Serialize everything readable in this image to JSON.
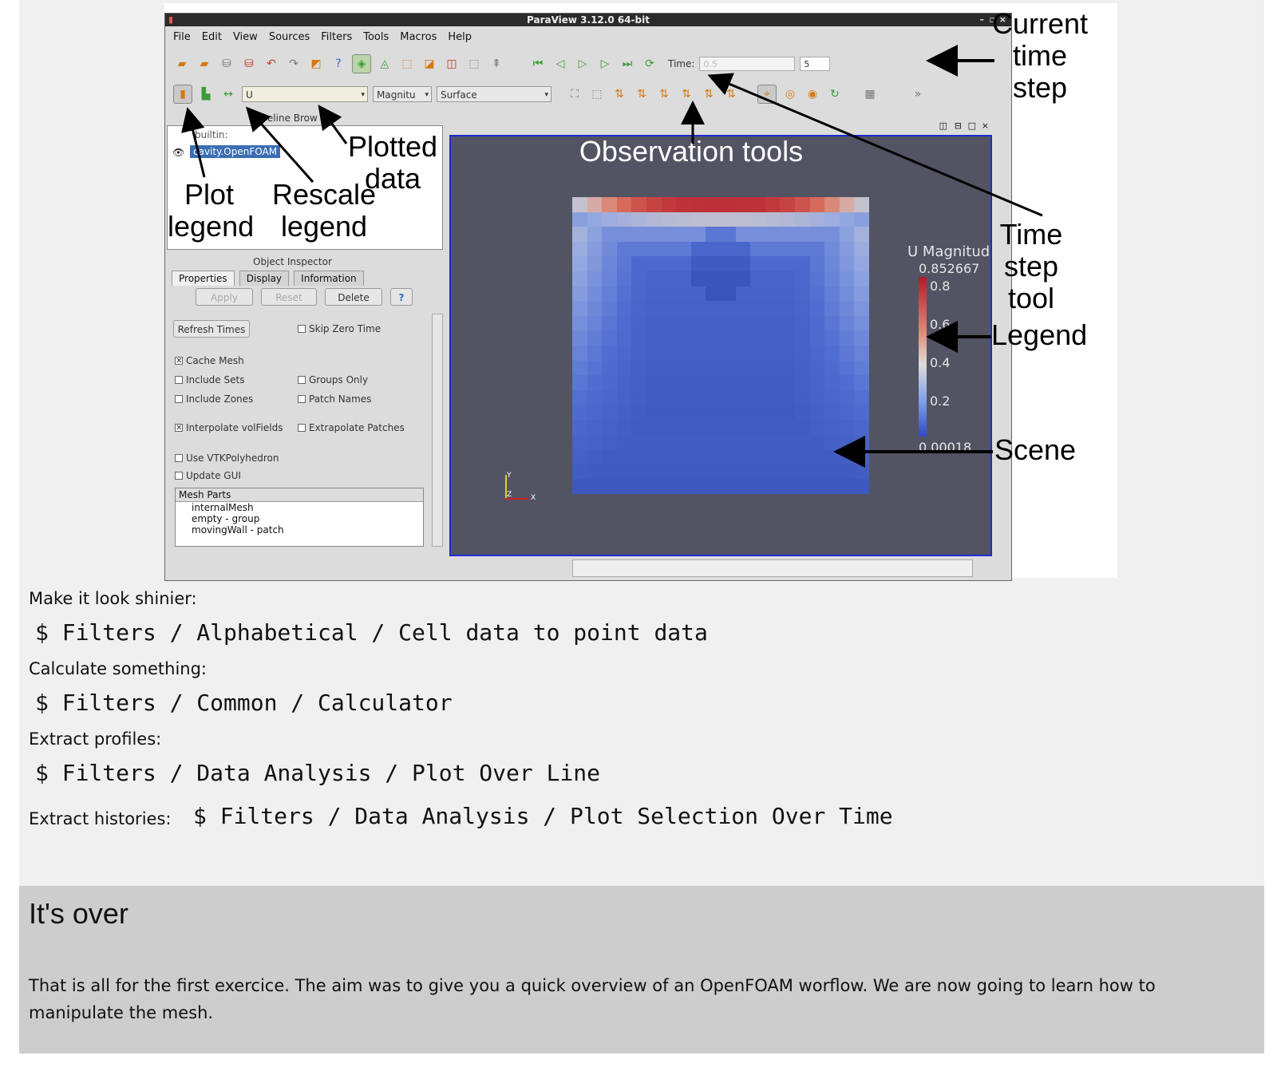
{
  "window": {
    "title": "ParaView 3.12.0 64-bit"
  },
  "menu": [
    "File",
    "Edit",
    "View",
    "Sources",
    "Filters",
    "Tools",
    "Macros",
    "Help"
  ],
  "toolbar": {
    "time_label": "Time:",
    "time_value": "0.5",
    "time_step": "5",
    "variable": "U",
    "component": "Magnitu",
    "representation": "Surface"
  },
  "pipeline": {
    "title": "Pipeline Brow",
    "items": [
      "builtin:",
      "cavity.OpenFOAM"
    ]
  },
  "inspector": {
    "title": "Object Inspector",
    "tabs": [
      "Properties",
      "Display",
      "Information"
    ],
    "buttons": {
      "apply": "Apply",
      "reset": "Reset",
      "delete": "Delete",
      "help": "?"
    },
    "refresh": "Refresh Times",
    "checks": [
      {
        "label": "Skip Zero Time",
        "checked": false
      },
      {
        "label": "Cache Mesh",
        "checked": true
      },
      {
        "label": "Include Sets",
        "checked": false
      },
      {
        "label": "Groups Only",
        "checked": false
      },
      {
        "label": "Include Zones",
        "checked": false
      },
      {
        "label": "Patch Names",
        "checked": false
      },
      {
        "label": "Interpolate volFields",
        "checked": true
      },
      {
        "label": "Extrapolate Patches",
        "checked": false
      },
      {
        "label": "Use VTKPolyhedron",
        "checked": false
      },
      {
        "label": "Update GUI",
        "checked": false
      }
    ],
    "mesh_header": "Mesh Parts",
    "mesh_parts": [
      "internalMesh",
      "empty - group",
      "movingWall - patch"
    ]
  },
  "scene": {
    "legend_title": "U Magnitud",
    "legend_max": "0.852667",
    "legend_min": "0.00018",
    "legend_ticks": [
      "0.8",
      "0.6",
      "0.4",
      "0.2"
    ],
    "axes": {
      "y": "Y",
      "z": "Z",
      "x": "X"
    }
  },
  "annotations": {
    "current_time_step": "Current time step",
    "observation_tools": "Observation tools",
    "plotted_data": "Plotted data",
    "plot_legend": "Plot legend",
    "rescale_legend": "Rescale legend",
    "time_step_tool": "Time step tool",
    "legend": "Legend",
    "scene": "Scene"
  },
  "body": [
    {
      "text": "Make it look shinier:",
      "code": "$ Filters / Alphabetical / Cell data to point data"
    },
    {
      "text": "Calculate something:",
      "code": "$ Filters / Common / Calculator"
    },
    {
      "text": "Extract profiles:",
      "code": "$ Filters / Data Analysis / Plot Over Line"
    },
    {
      "text": "Extract histories:",
      "code": "$ Filters / Data Analysis / Plot Selection Over Time"
    }
  ],
  "section": {
    "title": "It's over",
    "paragraph": "That is all for the first exercice. The aim was to give you a quick overview of an OpenFOAM worflow. We are now going to learn how to manipulate the mesh."
  },
  "colors": {
    "scene_bg": "#525463",
    "scene_border": "#1d2bd6",
    "section_bg": "#cdcdcd",
    "slide_bg": "#f0f0f0"
  }
}
